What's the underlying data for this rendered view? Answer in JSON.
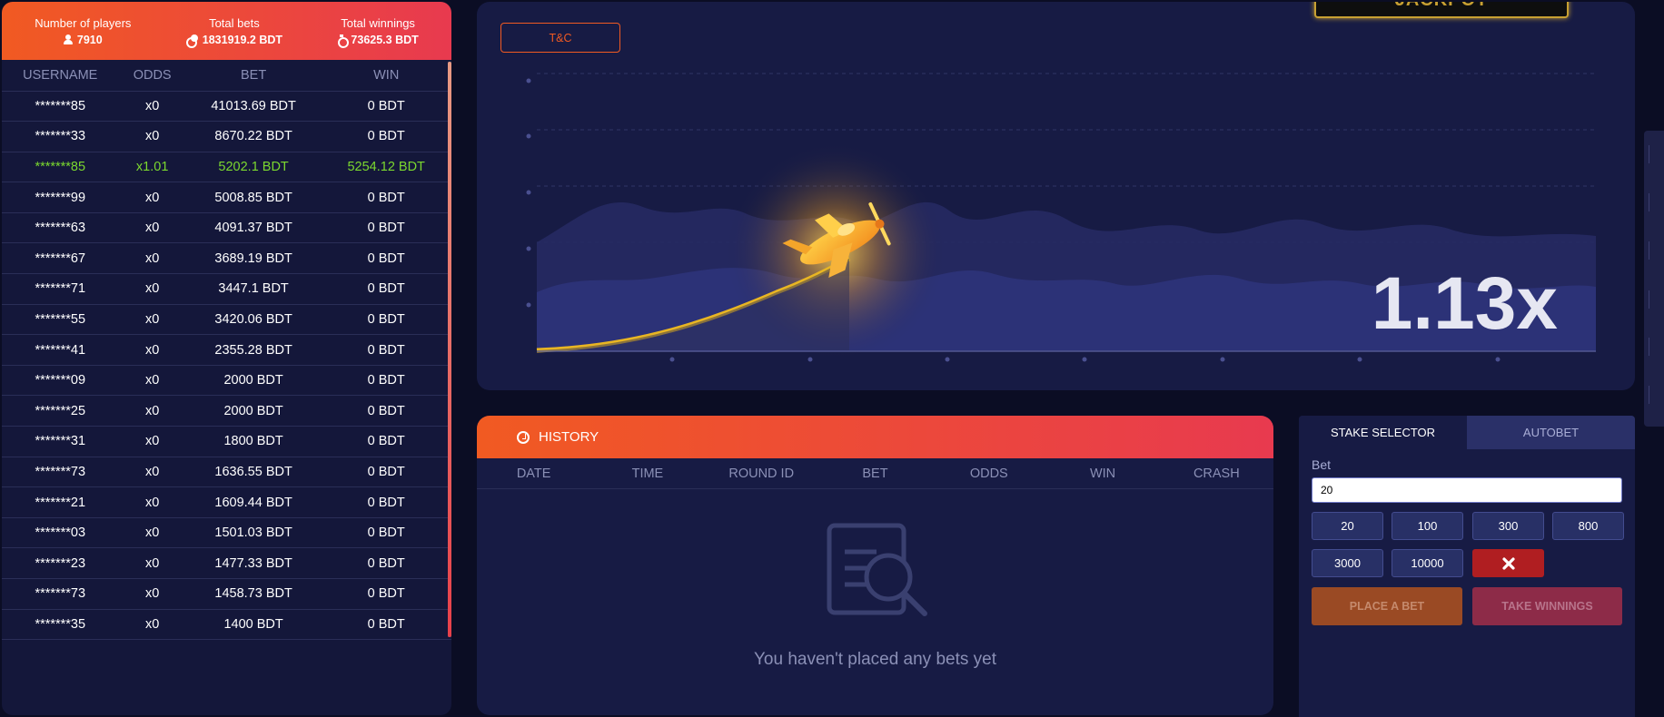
{
  "stats": {
    "players_label": "Number of players",
    "players_value": "7910",
    "bets_label": "Total bets",
    "bets_value": "1831919.2 BDT",
    "winnings_label": "Total winnings",
    "winnings_value": "73625.3 BDT"
  },
  "players_table": {
    "headers": [
      "USERNAME",
      "ODDS",
      "BET",
      "WIN"
    ],
    "rows": [
      {
        "user": "*******85",
        "odds": "x0",
        "bet": "41013.69 BDT",
        "win": "0 BDT",
        "won": false
      },
      {
        "user": "*******33",
        "odds": "x0",
        "bet": "8670.22 BDT",
        "win": "0 BDT",
        "won": false
      },
      {
        "user": "*******85",
        "odds": "x1.01",
        "bet": "5202.1 BDT",
        "win": "5254.12 BDT",
        "won": true
      },
      {
        "user": "*******99",
        "odds": "x0",
        "bet": "5008.85 BDT",
        "win": "0 BDT",
        "won": false
      },
      {
        "user": "*******63",
        "odds": "x0",
        "bet": "4091.37 BDT",
        "win": "0 BDT",
        "won": false
      },
      {
        "user": "*******67",
        "odds": "x0",
        "bet": "3689.19 BDT",
        "win": "0 BDT",
        "won": false
      },
      {
        "user": "*******71",
        "odds": "x0",
        "bet": "3447.1 BDT",
        "win": "0 BDT",
        "won": false
      },
      {
        "user": "*******55",
        "odds": "x0",
        "bet": "3420.06 BDT",
        "win": "0 BDT",
        "won": false
      },
      {
        "user": "*******41",
        "odds": "x0",
        "bet": "2355.28 BDT",
        "win": "0 BDT",
        "won": false
      },
      {
        "user": "*******09",
        "odds": "x0",
        "bet": "2000 BDT",
        "win": "0 BDT",
        "won": false
      },
      {
        "user": "*******25",
        "odds": "x0",
        "bet": "2000 BDT",
        "win": "0 BDT",
        "won": false
      },
      {
        "user": "*******31",
        "odds": "x0",
        "bet": "1800 BDT",
        "win": "0 BDT",
        "won": false
      },
      {
        "user": "*******73",
        "odds": "x0",
        "bet": "1636.55 BDT",
        "win": "0 BDT",
        "won": false
      },
      {
        "user": "*******21",
        "odds": "x0",
        "bet": "1609.44 BDT",
        "win": "0 BDT",
        "won": false
      },
      {
        "user": "*******03",
        "odds": "x0",
        "bet": "1501.03 BDT",
        "win": "0 BDT",
        "won": false
      },
      {
        "user": "*******23",
        "odds": "x0",
        "bet": "1477.33 BDT",
        "win": "0 BDT",
        "won": false
      },
      {
        "user": "*******73",
        "odds": "x0",
        "bet": "1458.73 BDT",
        "win": "0 BDT",
        "won": false
      },
      {
        "user": "*******35",
        "odds": "x0",
        "bet": "1400 BDT",
        "win": "0 BDT",
        "won": false
      }
    ]
  },
  "game": {
    "tc_label": "T&C",
    "jackpot_label": "JACKPOT",
    "multiplier": "1.13x"
  },
  "history": {
    "title": "HISTORY",
    "columns": [
      "DATE",
      "TIME",
      "ROUND ID",
      "BET",
      "ODDS",
      "WIN",
      "CRASH"
    ],
    "empty_text": "You haven't placed any bets yet"
  },
  "bet_panel": {
    "tab_stake": "STAKE SELECTOR",
    "tab_autobet": "AUTOBET",
    "bet_label": "Bet",
    "bet_value": "20",
    "chips": [
      "20",
      "100",
      "300",
      "800",
      "3000",
      "10000"
    ],
    "place_label": "PLACE A BET",
    "take_label": "TAKE WINNINGS"
  },
  "colors": {
    "accent_orange": "#f15a22",
    "accent_red": "#e83a4f",
    "win_green": "#7bd82f",
    "panel_bg": "#14173a"
  }
}
